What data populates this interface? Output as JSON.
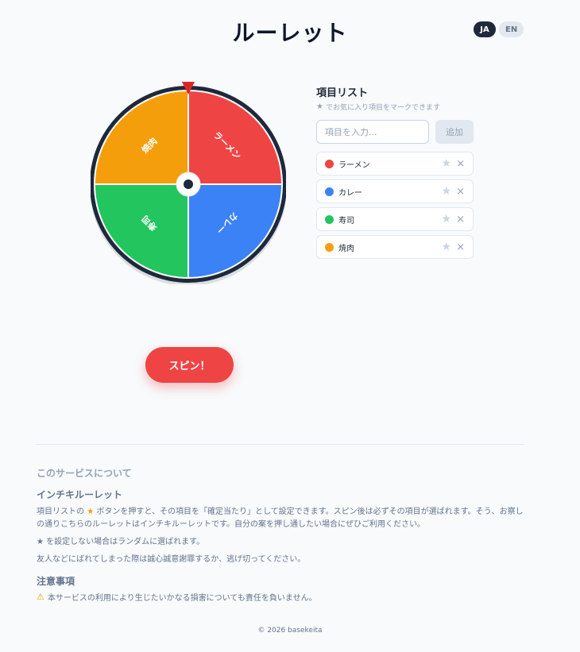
{
  "header": {
    "title": "ルーレット",
    "lang_ja": "JA",
    "lang_en": "EN"
  },
  "wheel": {
    "segments": [
      {
        "label": "ラーメン",
        "color": "#ef4444"
      },
      {
        "label": "カレー",
        "color": "#3b82f6"
      },
      {
        "label": "寿司",
        "color": "#22c55e"
      },
      {
        "label": "焼肉",
        "color": "#f59e0b"
      }
    ],
    "rim_color": "#1e293b",
    "pointer_color": "#dc2626"
  },
  "items_panel": {
    "title": "項目リスト",
    "hint_star": "★",
    "hint": "でお気に入り項目をマークできます",
    "input_placeholder": "項目を入力...",
    "add_label": "追加",
    "items": [
      {
        "label": "ラーメン",
        "color": "#ef4444",
        "star": "★",
        "remove": "×"
      },
      {
        "label": "カレー",
        "color": "#3b82f6",
        "star": "★",
        "remove": "×"
      },
      {
        "label": "寿司",
        "color": "#22c55e",
        "star": "★",
        "remove": "×"
      },
      {
        "label": "焼肉",
        "color": "#f59e0b",
        "star": "★",
        "remove": "×"
      }
    ]
  },
  "spin": {
    "label": "スピン！"
  },
  "about": {
    "heading": "このサービスについて",
    "sub": "インチキルーレット",
    "p1_prefix": "項目リストの",
    "p1_star": "★",
    "p1_rest": "ボタンを押すと、その項目を「確定当たり」として設定できます。スピン後は必ずその項目が選ばれます。そう、お察しの通りこちらのルーレットはインチキルーレットです。自分の案を押し通したい場合にぜひご利用ください。",
    "p2_star": "★",
    "p2_rest": "を設定しない場合はランダムに選ばれます。",
    "p3": "友人などにばれてしまった際は誠心誠意謝罪するか、逃げ切ってください。",
    "notice_heading": "注意事項",
    "notice_icon": "⚠",
    "notice_text": "本サービスの利用により生じたいかなる損害についても責任を負いません。"
  },
  "footer": {
    "text": "© 2026 basekeita"
  }
}
